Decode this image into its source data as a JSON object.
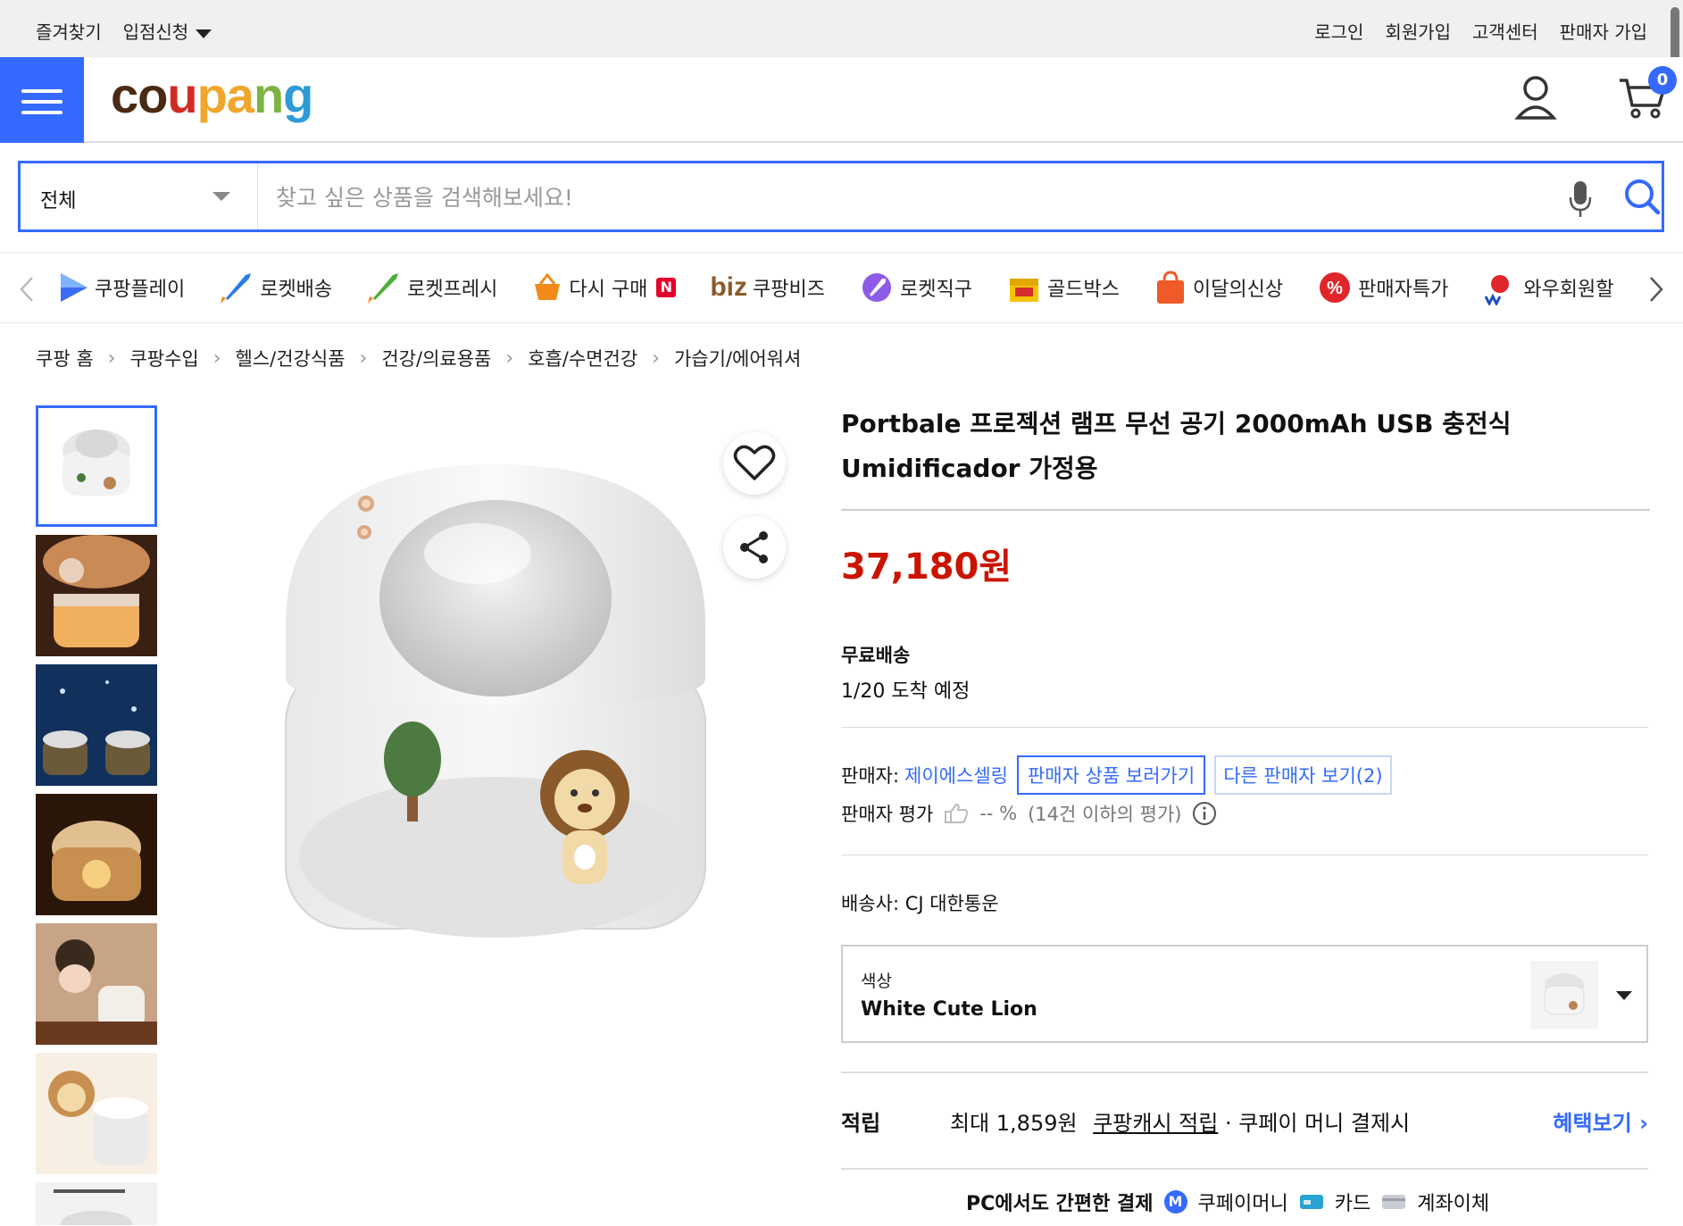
{
  "topbar": {
    "bookmark": "즐겨찾기",
    "partner": "입점신청",
    "login": "로그인",
    "signup": "회원가입",
    "support": "고객센터",
    "seller_signup": "판매자 가입"
  },
  "header": {
    "logo_parts": [
      "co",
      "u",
      "pa",
      "n",
      "g"
    ],
    "cart_count": "0"
  },
  "search": {
    "category": "전체",
    "placeholder": "찾고 싶은 상품을 검색해보세요!"
  },
  "nav": {
    "items": [
      {
        "label": "쿠팡플레이",
        "icon": "play-icon"
      },
      {
        "label": "로켓배송",
        "icon": "rocket-icon"
      },
      {
        "label": "로켓프레시",
        "icon": "rocket-fresh-icon"
      },
      {
        "label": "다시 구매",
        "icon": "basket-icon",
        "badge": "N"
      },
      {
        "label": "쿠팡비즈",
        "icon": "biz-icon",
        "prefix": "biz"
      },
      {
        "label": "로켓직구",
        "icon": "rocket-global-icon"
      },
      {
        "label": "골드박스",
        "icon": "goldbox-icon"
      },
      {
        "label": "이달의신상",
        "icon": "new-bag-icon"
      },
      {
        "label": "판매자특가",
        "icon": "percent-badge-icon"
      },
      {
        "label": "와우회원할",
        "icon": "wow-icon"
      }
    ]
  },
  "breadcrumb": [
    "쿠팡 홈",
    "쿠팡수입",
    "헬스/건강식품",
    "건강/의료용품",
    "호흡/수면건강",
    "가습기/에어워셔"
  ],
  "product": {
    "title": "Portbale 프로젝션 램프 무선 공기 2000mAh USB 충전식 Umidificador 가정용",
    "price": "37,180원",
    "shipping_title": "무료배송",
    "shipping_eta": "1/20 도착 예정",
    "seller_label": "판매자:",
    "seller_name": "제이에스셀링",
    "seller_products_button": "판매자 상품 보러가기",
    "other_sellers_button": "다른 판매자 보기(2)",
    "seller_rating_label": "판매자 평가",
    "seller_rating_value": "-- %",
    "seller_rating_note": "(14건 이하의 평가)",
    "carrier": "배송사:  CJ 대한통운",
    "option_label": "색상",
    "option_value": "White Cute Lion",
    "reward_label": "적립",
    "reward_text_1": "최대 1,859원",
    "reward_text_2": "쿠팡캐시 적립",
    "reward_text_3": " · 쿠페이 머니 결제시",
    "reward_link": "혜택보기 ›",
    "pay_title": "PC에서도 간편한 결제",
    "pay_coupay": "쿠페이머니",
    "pay_card": "카드",
    "pay_account": "계좌이체"
  },
  "colors": {
    "accent": "#346aff",
    "price": "#cb1400"
  }
}
